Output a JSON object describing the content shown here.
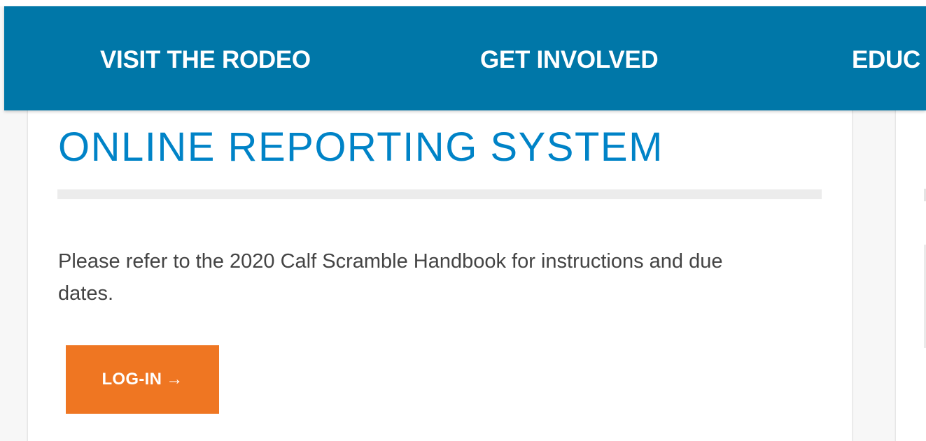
{
  "nav": {
    "items": [
      {
        "label": "VISIT THE RODEO"
      },
      {
        "label": "GET INVOLVED"
      },
      {
        "label": "EDUC"
      }
    ]
  },
  "main": {
    "title": "ONLINE REPORTING SYSTEM",
    "body": "Please refer to the 2020 Calf Scramble Handbook for instructions and due dates.",
    "login_label": "LOG-IN",
    "login_icon": "arrow-right-icon",
    "login_arrow": "→"
  },
  "colors": {
    "nav_background": "#0077a8",
    "title": "#0083c7",
    "button": "#ef7622"
  }
}
